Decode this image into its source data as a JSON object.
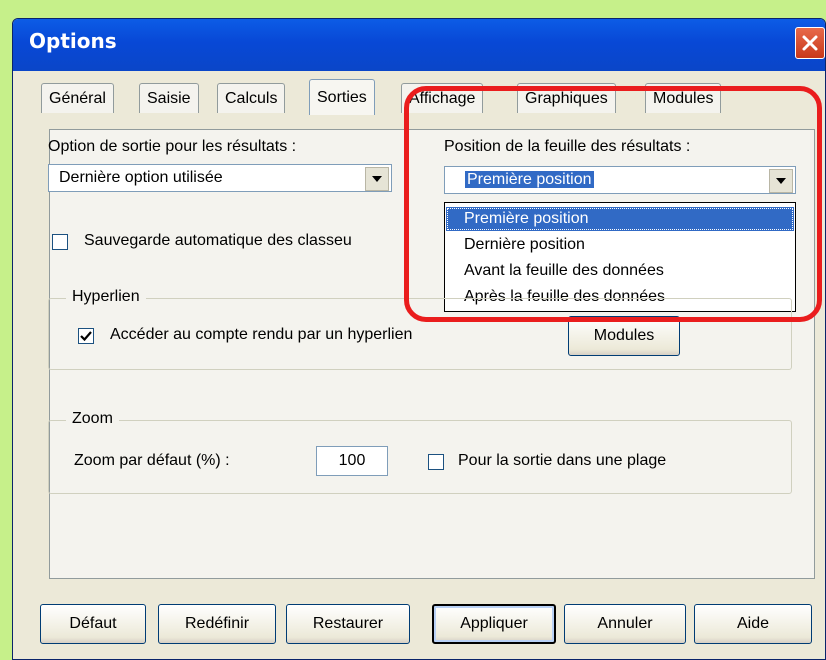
{
  "window": {
    "title": "Options"
  },
  "tabs": [
    {
      "label": "Général"
    },
    {
      "label": "Saisie"
    },
    {
      "label": "Calculs"
    },
    {
      "label": "Sorties"
    },
    {
      "label": "Affichage"
    },
    {
      "label": "Graphiques"
    },
    {
      "label": "Modules"
    }
  ],
  "output": {
    "label": "Option de sortie pour les résultats :",
    "value": "Dernière option utilisée"
  },
  "position": {
    "label": "Position de la feuille des résultats :",
    "value": "Première position",
    "options": [
      "Première position",
      "Dernière position",
      "Avant la feuille des données",
      "Après la feuille des données"
    ]
  },
  "autosave": {
    "label": "Sauvegarde automatique des classeu",
    "checked": false
  },
  "hyperlink": {
    "legend": "Hyperlien",
    "checkbox_label": "Accéder au compte rendu par un hyperlien",
    "checked": true,
    "modules_button": "Modules"
  },
  "zoom": {
    "legend": "Zoom",
    "label": "Zoom par défaut (%) :",
    "value": "100",
    "range_label": "Pour la sortie dans une plage",
    "range_checked": false
  },
  "buttons": {
    "default": "Défaut",
    "redefine": "Redéfinir",
    "restore": "Restaurer",
    "apply": "Appliquer",
    "cancel": "Annuler",
    "help": "Aide"
  },
  "colors": {
    "title_bar": "#0a46c8",
    "highlight": "#316ac5",
    "annotation": "#ea1d1d",
    "background": "#c6f08a"
  }
}
